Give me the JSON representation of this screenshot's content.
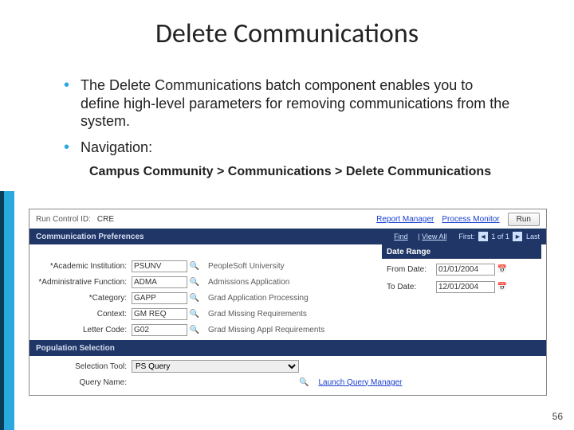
{
  "title": "Delete Communications",
  "bullets": [
    "The Delete Communications batch component enables you to define high-level parameters for removing communications from the system.",
    "Navigation:"
  ],
  "nav_path": "Campus Community > Communications > Delete Communications",
  "page_number": "56",
  "screenshot": {
    "run_control": {
      "label": "Run Control ID:",
      "value": "CRE"
    },
    "links": {
      "report_manager": "Report Manager",
      "process_monitor": "Process Monitor"
    },
    "run_button": "Run",
    "pref_bar": {
      "title": "Communication Preferences",
      "util": {
        "find": "Find",
        "viewall": "View All",
        "pager": "1 of 1",
        "first": "First:",
        "last": "Last"
      }
    },
    "fields": {
      "institution": {
        "label": "*Academic Institution:",
        "value": "PSUNV",
        "desc": "PeopleSoft University"
      },
      "admin_func": {
        "label": "*Administrative Function:",
        "value": "ADMA",
        "desc": "Admissions Application"
      },
      "category": {
        "label": "*Category:",
        "value": "GAPP",
        "desc": "Grad Application Processing"
      },
      "context": {
        "label": "Context:",
        "value": "GM REQ",
        "desc": "Grad Missing Requirements"
      },
      "letter": {
        "label": "Letter Code:",
        "value": "G02",
        "desc": "Grad Missing Appl Requirements"
      }
    },
    "date_range": {
      "header": "Date Range",
      "from": {
        "label": "From Date:",
        "value": "01/01/2004"
      },
      "to": {
        "label": "To Date:",
        "value": "12/01/2004"
      }
    },
    "pop_bar": "Population Selection",
    "popsel": {
      "tool": {
        "label": "Selection Tool:",
        "value": "PS Query"
      },
      "query": {
        "label": "Query Name:",
        "link": "Launch Query Manager"
      }
    }
  }
}
